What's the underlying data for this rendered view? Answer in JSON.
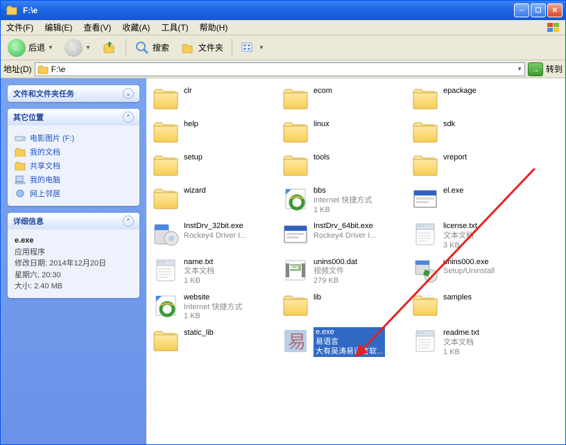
{
  "title": "F:\\e",
  "menubar": [
    "文件(F)",
    "编辑(E)",
    "查看(V)",
    "收藏(A)",
    "工具(T)",
    "帮助(H)"
  ],
  "toolbar": {
    "back": "后退",
    "search": "搜索",
    "folders": "文件夹"
  },
  "addressbar": {
    "label": "地址(D)",
    "path": "F:\\e",
    "go": "转到"
  },
  "sidebar": {
    "tasks_title": "文件和文件夹任务",
    "other_title": "其它位置",
    "other_links": [
      {
        "icon": "drive",
        "text": "电影图片 (F:)"
      },
      {
        "icon": "docs",
        "text": "我的文档"
      },
      {
        "icon": "shared",
        "text": "共享文档"
      },
      {
        "icon": "pc",
        "text": "我的电脑"
      },
      {
        "icon": "net",
        "text": "网上邻居"
      }
    ],
    "details_title": "详细信息",
    "details": {
      "name": "e.exe",
      "type": "应用程序",
      "mod_label": "修改日期:",
      "mod_value": "2014年12月20日",
      "weekday_time": "星期六, 20:30",
      "size_label": "大小:",
      "size_value": "2.40 MB"
    }
  },
  "items": [
    {
      "icon": "folder",
      "ln1": "clr"
    },
    {
      "icon": "folder",
      "ln1": "ecom"
    },
    {
      "icon": "folder",
      "ln1": "epackage"
    },
    {
      "icon": "folder",
      "ln1": "help"
    },
    {
      "icon": "folder",
      "ln1": "linux"
    },
    {
      "icon": "folder",
      "ln1": "sdk"
    },
    {
      "icon": "folder",
      "ln1": "setup"
    },
    {
      "icon": "folder",
      "ln1": "tools"
    },
    {
      "icon": "folder",
      "ln1": "vreport"
    },
    {
      "icon": "folder",
      "ln1": "wizard"
    },
    {
      "icon": "ishortcut",
      "ln1": "bbs",
      "ln2": "Internet 快捷方式",
      "ln3": "1 KB"
    },
    {
      "icon": "app",
      "ln1": "el.exe"
    },
    {
      "icon": "installer",
      "ln1": "InstDrv_32bit.exe",
      "ln2": "Rockey4 Driver I..."
    },
    {
      "icon": "app",
      "ln1": "InstDrv_64bit.exe",
      "ln2": "Rockey4 Driver I..."
    },
    {
      "icon": "txt",
      "ln1": "license.txt",
      "ln2": "文本文档",
      "ln3": "3 KB"
    },
    {
      "icon": "txt",
      "ln1": "name.txt",
      "ln2": "文本文档",
      "ln3": "1 KB"
    },
    {
      "icon": "dat",
      "ln1": "unins000.dat",
      "ln2": "视频文件",
      "ln3": "279 KB"
    },
    {
      "icon": "uninst",
      "ln1": "unins000.exe",
      "ln2": "Setup/Uninstall"
    },
    {
      "icon": "ishortcut",
      "ln1": "website",
      "ln2": "Internet 快捷方式",
      "ln3": "1 KB"
    },
    {
      "icon": "folder",
      "ln1": "lib"
    },
    {
      "icon": "folder",
      "ln1": "samples"
    },
    {
      "icon": "folder",
      "ln1": "static_lib"
    },
    {
      "icon": "e",
      "ln1": "e.exe",
      "ln2": "易语言",
      "ln3": "大有吴涛易语言软...",
      "selected": true
    },
    {
      "icon": "txt",
      "ln1": "readme.txt",
      "ln2": "文本文档",
      "ln3": "1 KB"
    }
  ]
}
